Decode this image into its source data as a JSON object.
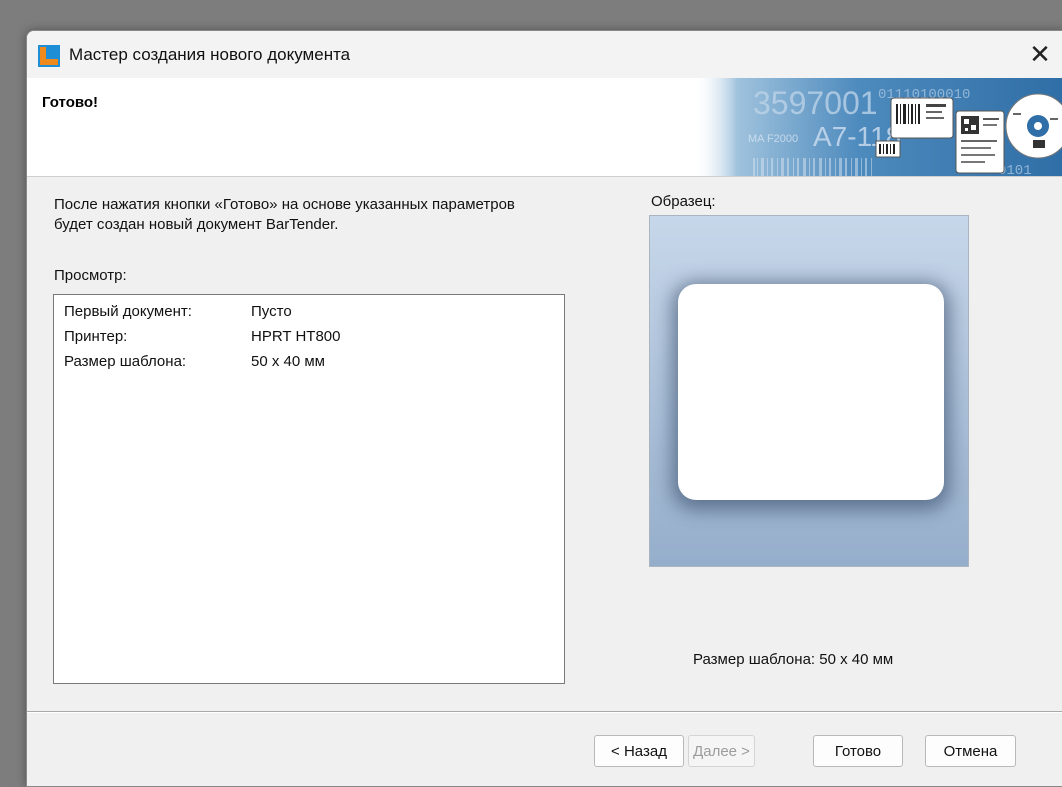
{
  "window": {
    "title": "Мастер создания нового документа",
    "close_glyph": "✕"
  },
  "header": {
    "title": "Готово!",
    "banner_text": {
      "digits_top": "3597001",
      "binary_top": "01110100010",
      "code": "A7-118",
      "small_code": "MA F2000",
      "binary_bottom": "0101"
    }
  },
  "description": "После нажатия кнопки «Готово» на основе указанных параметров будет создан новый документ BarTender.",
  "preview": {
    "label": "Просмотр:",
    "rows": [
      {
        "key": "Первый документ:",
        "value": "Пусто"
      },
      {
        "key": "Принтер:",
        "value": "HPRT HT800"
      },
      {
        "key": "Размер шаблона:",
        "value": "50 x 40 мм"
      }
    ]
  },
  "sample": {
    "label": "Образец:",
    "size_caption": "Размер шаблона:  50 x 40 мм"
  },
  "buttons": {
    "back": "< Назад",
    "next": "Далее >",
    "finish": "Готово",
    "cancel": "Отмена"
  },
  "colors": {
    "app_icon_blue": "#1e8fd6",
    "app_icon_orange": "#f08a1c",
    "banner_blue": "#3f7fb6",
    "sample_gradient_top": "#c7d7ea",
    "sample_gradient_bottom": "#95aecb"
  },
  "icons": {
    "app": "bartender-app-icon",
    "close": "close-icon"
  }
}
